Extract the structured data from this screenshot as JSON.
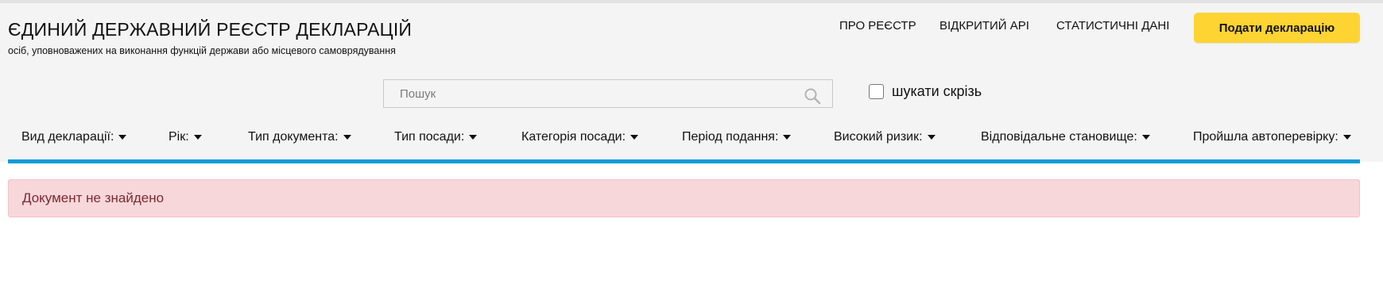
{
  "header": {
    "title": "ЄДИНИЙ ДЕРЖАВНИЙ РЕЄСТР ДЕКЛАРАЦІЙ",
    "subtitle": "осіб, уповноважених на виконання функцій держави або місцевого самоврядування",
    "nav": [
      {
        "label": "ПРО РЕЄСТР"
      },
      {
        "label": "ВІДКРИТИЙ API"
      },
      {
        "label": "СТАТИСТИЧНІ ДАНІ"
      }
    ],
    "submit_label": "Подати декларацію"
  },
  "search": {
    "placeholder": "Пошук",
    "value": "",
    "scope_checkbox_label": "шукати скрізь",
    "scope_checked": false
  },
  "filters": [
    {
      "label": "Вид декларації:"
    },
    {
      "label": "Рік:"
    },
    {
      "label": "Тип документа:"
    },
    {
      "label": "Тип посади:"
    },
    {
      "label": "Категорія посади:"
    },
    {
      "label": "Період подання:"
    },
    {
      "label": "Високий ризик:"
    },
    {
      "label": "Відповідальне становище:"
    },
    {
      "label": "Пройшла автоперевірку:"
    }
  ],
  "alert": {
    "message": "Документ не знайдено"
  },
  "colors": {
    "header_bg": "#f4f4f4",
    "submit_button": "#fed432",
    "accent_rule": "#0f9bd7",
    "alert_bg": "#f8d7da",
    "alert_text": "#7a2a33"
  },
  "icons": {
    "search": "search-icon",
    "dropdown": "caret-down-icon"
  }
}
